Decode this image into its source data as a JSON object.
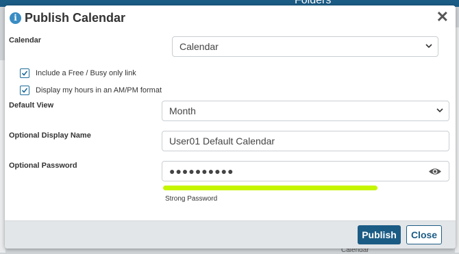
{
  "background": {
    "header_text": "Folders",
    "bottom_text": "Calendar"
  },
  "dialog": {
    "title": "Publish Calendar",
    "close_glyph": "✕",
    "info_glyph": "i"
  },
  "form": {
    "calendar_label": "Calendar",
    "calendar_value": "Calendar",
    "free_busy_label": "Include a Free / Busy only link",
    "free_busy_checked": true,
    "ampm_label": "Display my hours in an AM/PM format",
    "ampm_checked": true,
    "default_view_label": "Default View",
    "default_view_value": "Month",
    "display_name_label": "Optional Display Name",
    "display_name_value": "User01 Default Calendar",
    "password_label": "Optional Password",
    "password_value": "●●●●●●●●●●",
    "password_strength_text": "Strong Password",
    "password_strength_fraction": 1.0
  },
  "footer": {
    "publish_label": "Publish",
    "close_label": "Close"
  },
  "colors": {
    "primary": "#1b5c85",
    "strength_bar": "#c6f500",
    "info_icon": "#3a8dc4"
  },
  "icons": {
    "info": "info-icon",
    "close": "close-icon",
    "chevron": "chevron-down-icon",
    "eye": "eye-icon",
    "check": "check-icon"
  }
}
